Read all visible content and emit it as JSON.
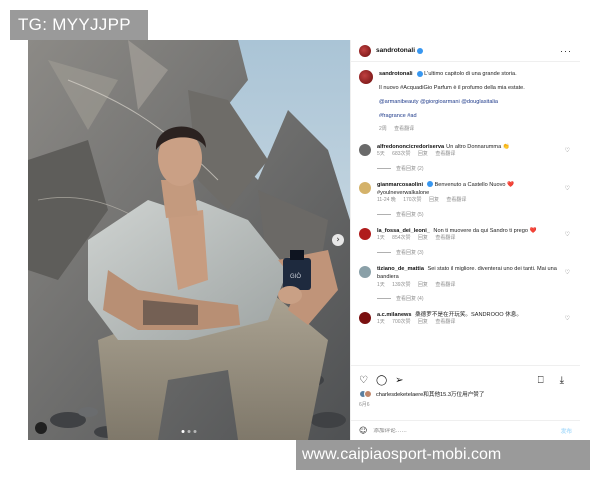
{
  "watermark_top": "TG: MYYJJPP",
  "watermark_bottom": "www.caipiaosport-mobi.com",
  "post": {
    "author": "sandrotonali",
    "more_icon": "more-horizontal-icon",
    "caption": {
      "line1": "L'ultimo capitolo di una grande storia.",
      "line2": "Il nuovo #AcquadiGio Parfum è il profumo della mia estate.",
      "line3": "@armanibeauty @giorgioarmani @douglasitalia",
      "line4": "#fragrance #ad",
      "time": "2周",
      "translate": "查看翻译"
    }
  },
  "comments": [
    {
      "user": "alfredononcicredoriserva",
      "text": "Un altro Donnarumma 👏",
      "time": "5天",
      "likes": "683次赞",
      "reply": "回复",
      "translate": "查看翻译",
      "replies": "查看回复 (2)",
      "avatar_color": "#6a6a6a"
    },
    {
      "user": "gianmarcosaolini",
      "verified": true,
      "text": "Benvenuto a Castello Nuovo ❤️ #youlneverwalkalone",
      "time": "11-24 晚",
      "likes": "170次赞",
      "reply": "回复",
      "translate": "查看翻译",
      "replies": "查看回复 (5)",
      "avatar_color": "#d4b26a"
    },
    {
      "user": "la_fossa_dei_leoni_",
      "text": "Non ti muovere da qui Sandro ti prego ❤️",
      "time": "1天",
      "likes": "854次赞",
      "reply": "回复",
      "translate": "查看翻译",
      "replies": "查看回复 (3)",
      "avatar_color": "#b01c1c"
    },
    {
      "user": "tiziano_de_mattia",
      "text": "Sei stato il migliore. diventerai uno dei tanti. Mai una bandiera",
      "time": "1天",
      "likes": "139次赞",
      "reply": "回复",
      "translate": "查看翻译",
      "replies": "查看回复 (4)",
      "avatar_color": "#8aa0a8"
    },
    {
      "user": "a.c.milanews",
      "text": "桑德罗不是在开玩笑。SANDROOO 休息。",
      "time": "1天",
      "likes": "700次赞",
      "reply": "回复",
      "translate": "查看翻译",
      "avatar_color": "#7a1010"
    }
  ],
  "actions": {
    "likes_text": "charlesdeketelaere和其他15.3万位用户赞了",
    "like_user": "charlesdeketelaere",
    "date": "6月6",
    "comment_placeholder": "添加评论……",
    "post_label": "发布"
  }
}
